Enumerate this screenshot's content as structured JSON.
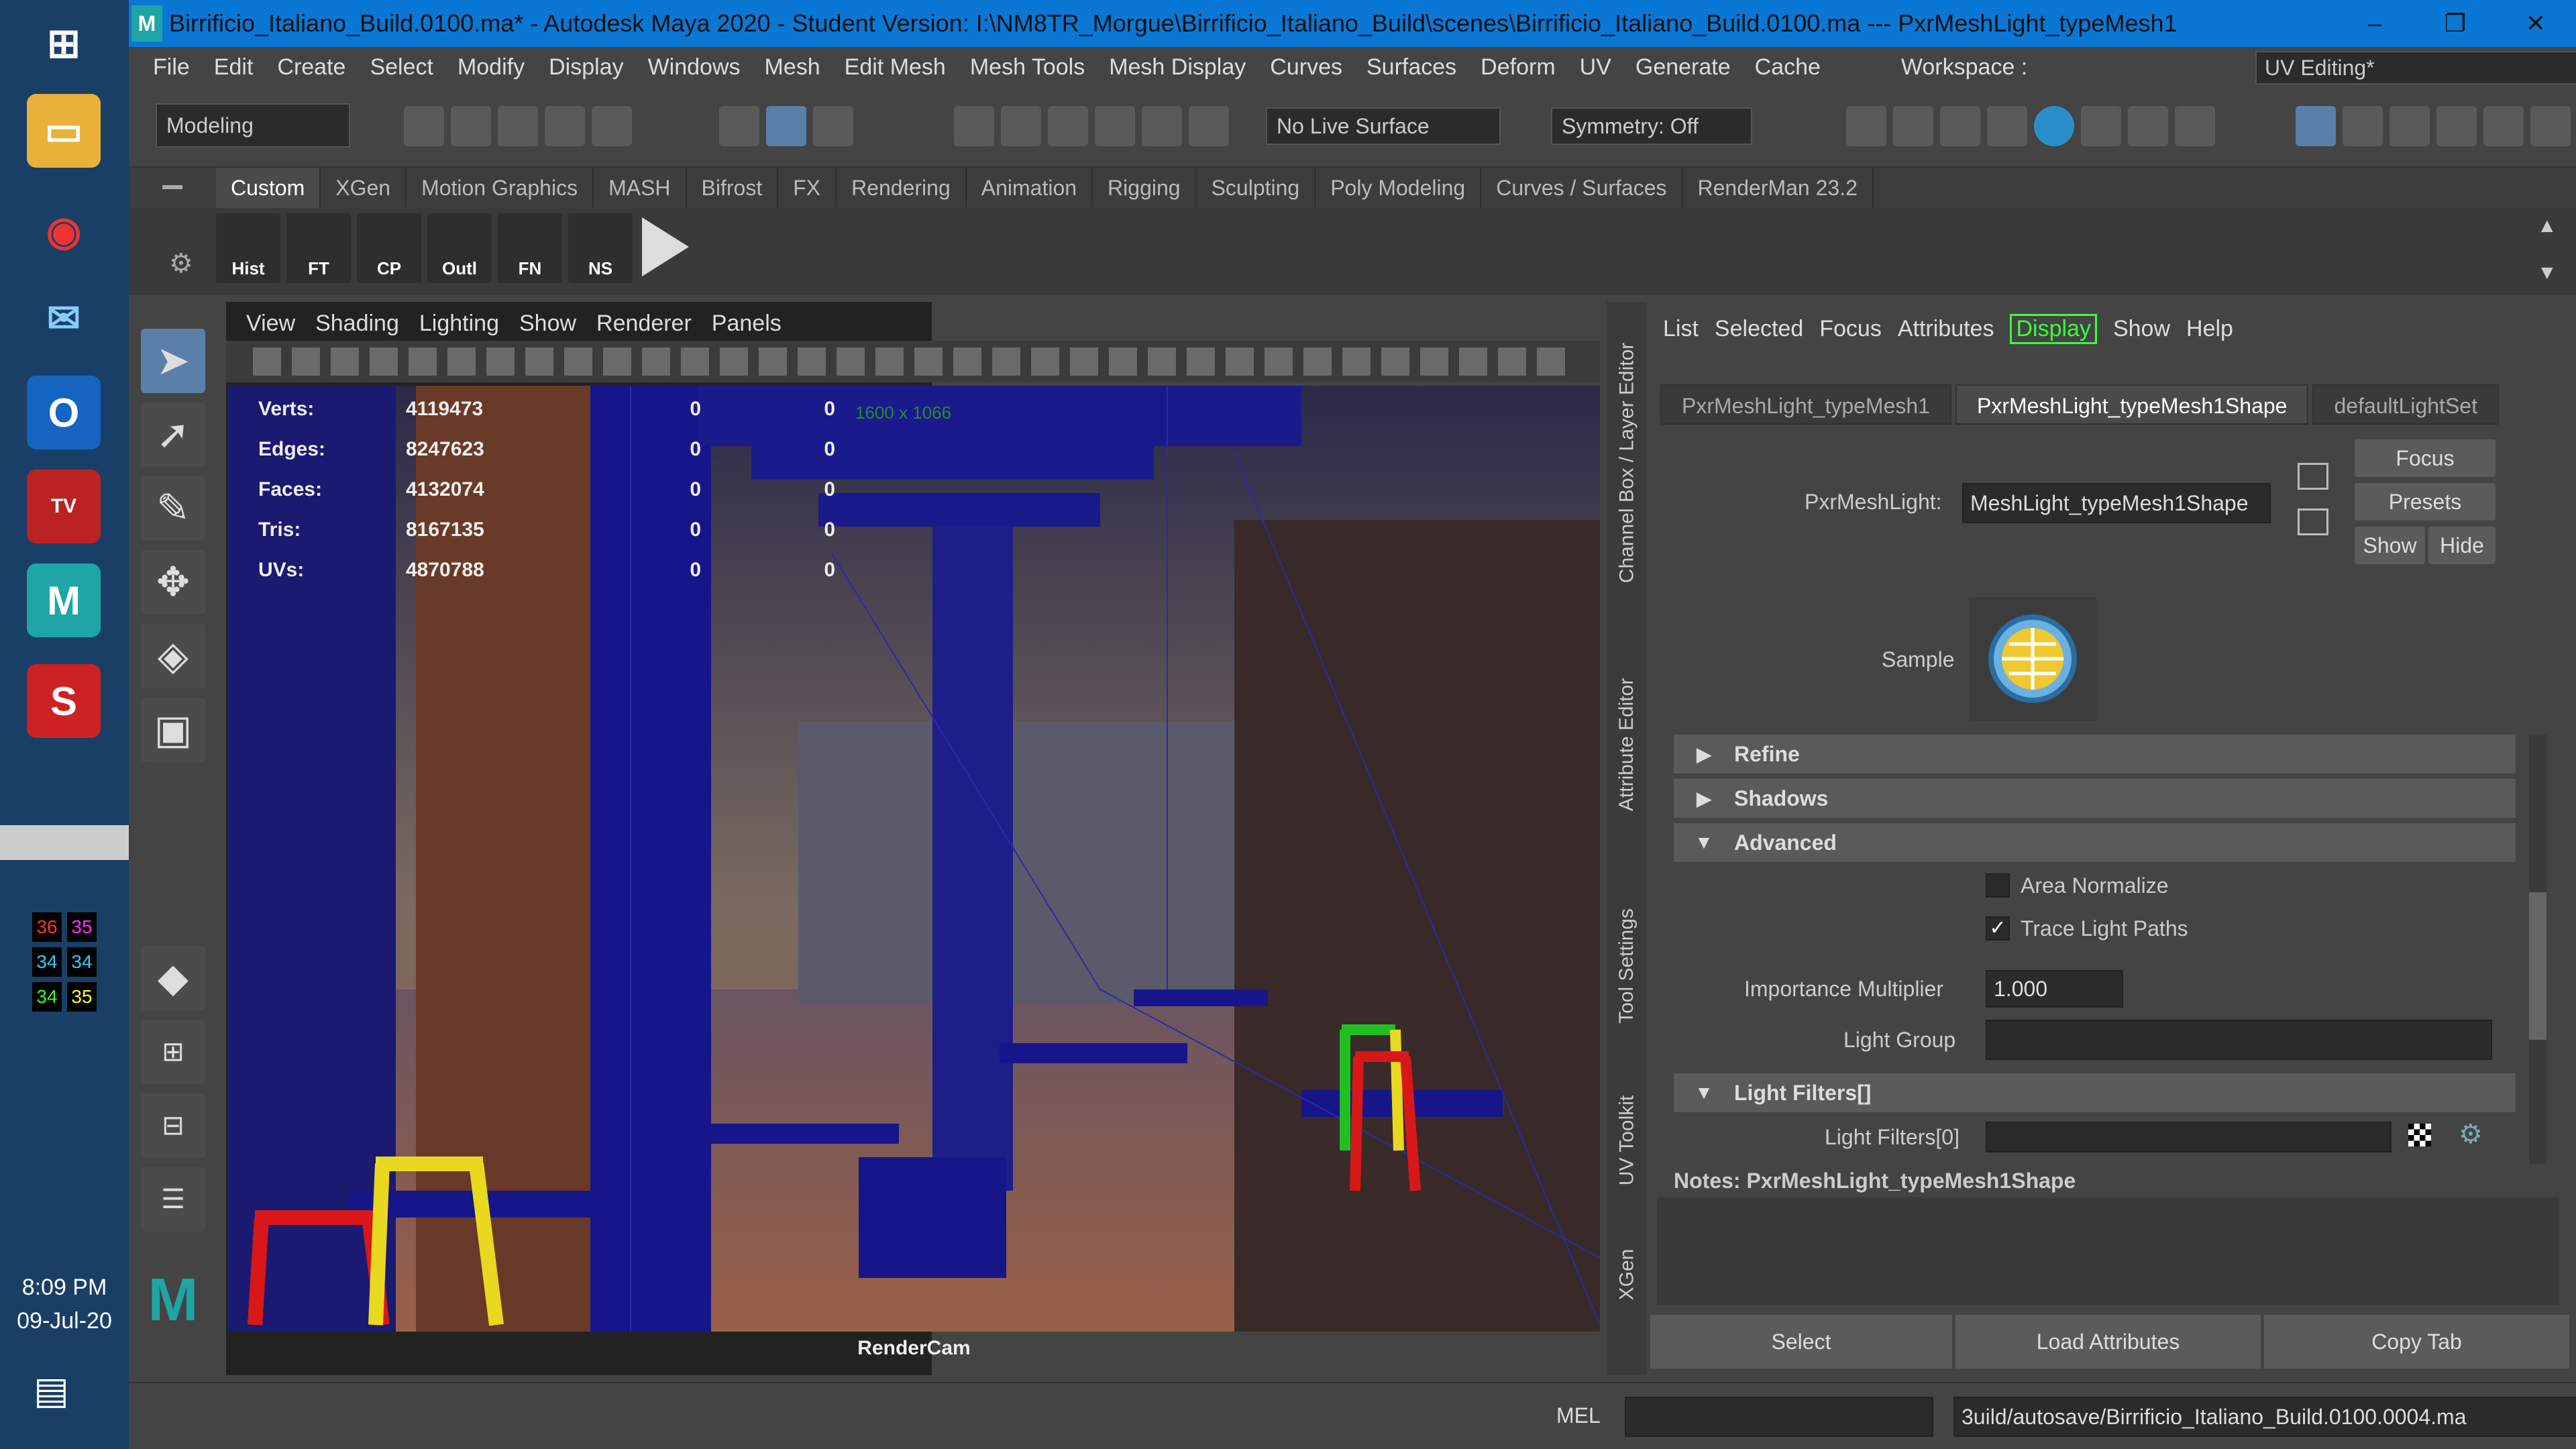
{
  "window": {
    "title": "Birrificio_Italiano_Build.0100.ma* - Autodesk Maya 2020 - Student Version: I:\\NM8TR_Morgue\\Birrificio_Italiano_Build\\scenes\\Birrificio_Italiano_Build.0100.ma   ---   PxrMeshLight_typeMesh1"
  },
  "menubar": [
    "File",
    "Edit",
    "Create",
    "Select",
    "Modify",
    "Display",
    "Windows",
    "Mesh",
    "Edit Mesh",
    "Mesh Tools",
    "Mesh Display",
    "Curves",
    "Surfaces",
    "Deform",
    "UV",
    "Generate",
    "Cache"
  ],
  "workspace": {
    "label": "Workspace :",
    "value": "UV Editing*"
  },
  "statusline": {
    "mode": "Modeling",
    "live_surface": "No Live Surface",
    "symmetry": "Symmetry: Off"
  },
  "shelf_tabs": [
    "Custom",
    "XGen",
    "Motion Graphics",
    "MASH",
    "Bifrost",
    "FX",
    "Rendering",
    "Animation",
    "Rigging",
    "Sculpting",
    "Poly Modeling",
    "Curves / Surfaces",
    "RenderMan 23.2"
  ],
  "shelf_buttons": [
    "Hist",
    "FT",
    "CP",
    "Outl",
    "FN",
    "NS"
  ],
  "viewport": {
    "menu": [
      "View",
      "Shading",
      "Lighting",
      "Show",
      "Renderer",
      "Panels"
    ],
    "resolution": "1600 x 1066",
    "camera": "RenderCam",
    "hud": [
      {
        "label": "Verts:",
        "v1": "4119473",
        "v2": "0",
        "v3": "0"
      },
      {
        "label": "Edges:",
        "v1": "8247623",
        "v2": "0",
        "v3": "0"
      },
      {
        "label": "Faces:",
        "v1": "4132074",
        "v2": "0",
        "v3": "0"
      },
      {
        "label": "Tris:",
        "v1": "8167135",
        "v2": "0",
        "v3": "0"
      },
      {
        "label": "UVs:",
        "v1": "4870788",
        "v2": "0",
        "v3": "0"
      }
    ]
  },
  "side_tabs": [
    "Channel Box / Layer Editor",
    "Attribute Editor",
    "Tool Settings",
    "UV Toolkit",
    "XGen"
  ],
  "attribute_editor": {
    "menu": [
      "List",
      "Selected",
      "Focus",
      "Attributes",
      "Display",
      "Show",
      "Help"
    ],
    "tabs": [
      "PxrMeshLight_typeMesh1",
      "PxrMeshLight_typeMesh1Shape",
      "defaultLightSet"
    ],
    "node_label": "PxrMeshLight:",
    "node_value": "MeshLight_typeMesh1Shape",
    "buttons": {
      "focus": "Focus",
      "presets": "Presets",
      "show": "Show",
      "hide": "Hide"
    },
    "sample_label": "Sample",
    "sections": {
      "refine": "Refine",
      "shadows": "Shadows",
      "advanced": "Advanced",
      "light_filters": "Light Filters[]"
    },
    "area_normalize": "Area Normalize",
    "trace_light_paths": "Trace Light Paths",
    "importance_label": "Importance Multiplier",
    "importance_value": "1.000",
    "light_group_label": "Light Group",
    "light_filters_item": "Light Filters[0]",
    "notes": "Notes:  PxrMeshLight_typeMesh1Shape",
    "bottom_buttons": [
      "Select",
      "Load Attributes",
      "Copy Tab"
    ]
  },
  "cmdline": {
    "lang": "MEL",
    "path": "3uild/autosave/Birrificio_Italiano_Build.0100.0004.ma"
  },
  "clock": {
    "time": "8:09 PM",
    "date": "09-Jul-20"
  },
  "tray_numbers": [
    "36",
    "35",
    "34",
    "34",
    "34",
    "35"
  ],
  "colors": {
    "title": "#0a77d4",
    "accent_green": "#39ff3b",
    "wire": "#1a1a8c"
  }
}
